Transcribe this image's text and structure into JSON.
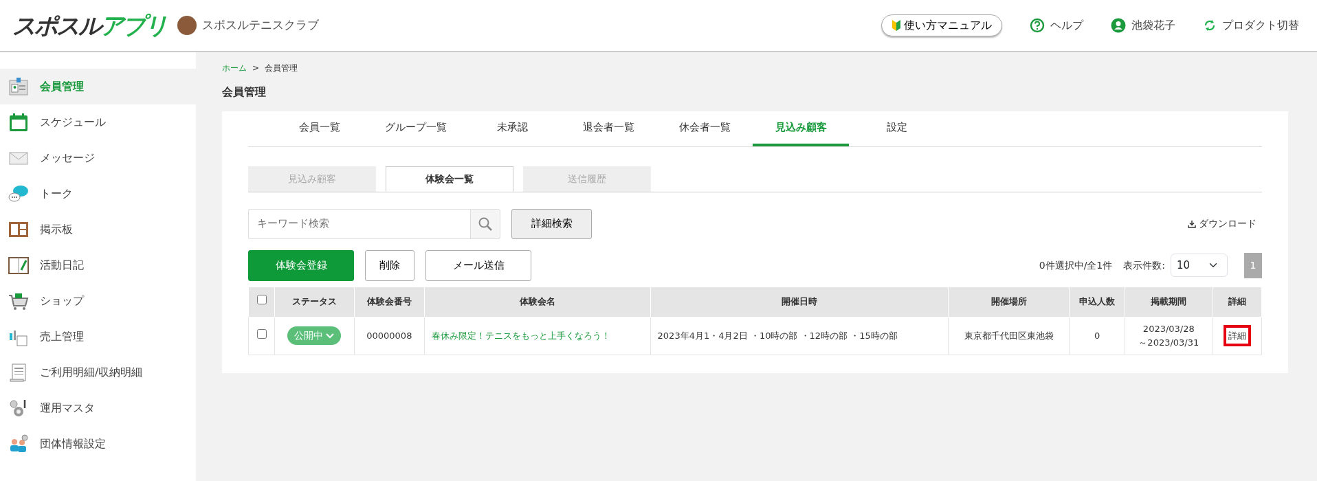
{
  "header": {
    "logo": {
      "part_1": "スポスル",
      "part_2": "アプリ"
    },
    "club_name": "スポスルテニスクラブ",
    "manual_button": "使い方マニュアル",
    "help": "ヘルプ",
    "user": "池袋花子",
    "switch_product": "プロダクト切替"
  },
  "sidebar": {
    "items": [
      {
        "label": "会員管理",
        "selected": true
      },
      {
        "label": "スケジュール",
        "selected": false
      },
      {
        "label": "メッセージ",
        "selected": false
      },
      {
        "label": "トーク",
        "selected": false
      },
      {
        "label": "掲示板",
        "selected": false
      },
      {
        "label": "活動日記",
        "selected": false
      },
      {
        "label": "ショップ",
        "selected": false
      },
      {
        "label": "売上管理",
        "selected": false
      },
      {
        "label": "ご利用明細/収納明細",
        "selected": false
      },
      {
        "label": "運用マスタ",
        "selected": false
      },
      {
        "label": "団体情報設定",
        "selected": false
      }
    ]
  },
  "breadcrumb": {
    "home": "ホーム",
    "separator": ">",
    "current": "会員管理"
  },
  "page_title": "会員管理",
  "tabs": [
    {
      "label": "会員一覧",
      "selected": false
    },
    {
      "label": "グループ一覧",
      "selected": false
    },
    {
      "label": "未承認",
      "selected": false
    },
    {
      "label": "退会者一覧",
      "selected": false
    },
    {
      "label": "休会者一覧",
      "selected": false
    },
    {
      "label": "見込み顧客",
      "selected": true
    },
    {
      "label": "設定",
      "selected": false
    }
  ],
  "subtabs": [
    {
      "label": "見込み顧客",
      "selected": false
    },
    {
      "label": "体験会一覧",
      "selected": true
    },
    {
      "label": "送信履歴",
      "selected": false
    }
  ],
  "search": {
    "placeholder": "キーワード検索",
    "advanced_button": "詳細検索"
  },
  "download": "ダウンロード",
  "actions": [
    "体験会登録",
    "削除",
    "メール送信"
  ],
  "summary": "0件選択中/全1件",
  "page_size": {
    "label": "表示件数:",
    "value": "10"
  },
  "pages": [
    {
      "label": "1",
      "selected": true
    }
  ],
  "table": {
    "select_all_checked": false,
    "columns": [
      "ステータス",
      "体験会番号",
      "体験会名",
      "開催日時",
      "開催場所",
      "申込人数",
      "掲載期間",
      "詳細"
    ],
    "rows": [
      {
        "checked": false,
        "status": "公開中",
        "number": "00000008",
        "name": "春休み限定！テニスをもっと上手くなろう！",
        "datetime": "2023年4月1・4月2日 ・10時の部 ・12時の部 ・15時の部",
        "place": "東京都千代田区東池袋",
        "applicants": "0",
        "period_start": "2023/03/28",
        "period_end": "～2023/03/31",
        "detail": "詳細",
        "detail_highlighted": true
      }
    ]
  }
}
